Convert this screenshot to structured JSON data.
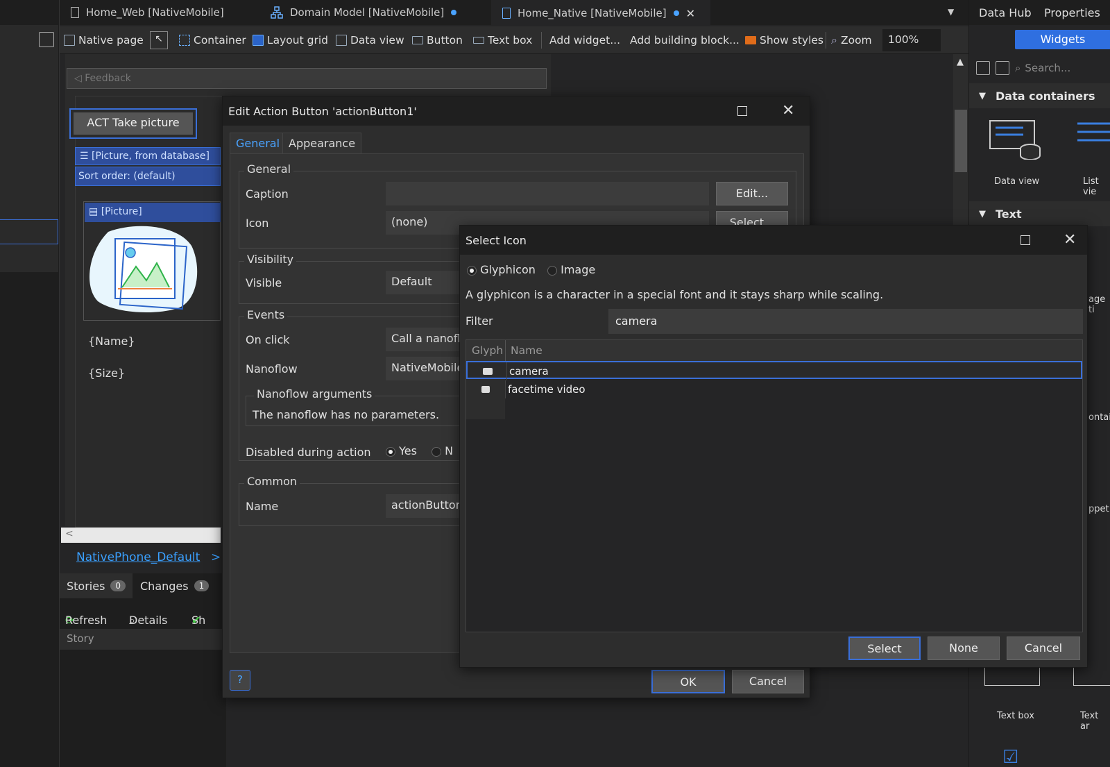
{
  "tabs": [
    {
      "label": "Home_Web [NativeMobile]",
      "dirty": false
    },
    {
      "label": "Domain Model [NativeMobile]",
      "dirty": true
    },
    {
      "label": "Home_Native [NativeMobile]",
      "dirty": true
    }
  ],
  "toolbar": {
    "native_page": "Native page",
    "container": "Container",
    "layout_grid": "Layout grid",
    "data_view": "Data view",
    "button": "Button",
    "text_box": "Text box",
    "add_widget": "Add widget...",
    "add_building_block": "Add building block...",
    "show_styles": "Show styles",
    "zoom_label": "Zoom",
    "zoom_value": "100%"
  },
  "right_panel": {
    "tab_data_hub": "Data Hub",
    "tab_properties": "Properties",
    "widgets_button": "Widgets",
    "search_placeholder": "Search...",
    "section_data_containers": "Data containers",
    "section_text": "Text",
    "items": {
      "data_view": "Data view",
      "list_view": "List vie",
      "image_text": "age ti",
      "container": "ontair",
      "snippet": "ppet",
      "text_box": "Text box",
      "text_area": "Text ar"
    }
  },
  "canvas": {
    "feedback": "Feedback",
    "action_button": "ACT Take picture",
    "list_header": "[Picture, from database]",
    "sort_order": "Sort order: (default)",
    "picture_header": "[Picture]",
    "name_tpl": "{Name}",
    "size_tpl": "{Size}",
    "breadcrumb_link": "NativePhone_Default",
    "breadcrumb_arrow": ">"
  },
  "bottom_pane": {
    "tab_stories": "Stories",
    "stories_count": "0",
    "tab_changes": "Changes",
    "changes_count": "1",
    "refresh": "Refresh",
    "details": "Details",
    "show": "Sh",
    "story_col": "Story"
  },
  "edit_dialog": {
    "title": "Edit Action Button 'actionButton1'",
    "tab_general": "General",
    "tab_appearance": "Appearance",
    "grp_general": "General",
    "caption_label": "Caption",
    "caption_value": "",
    "edit_button": "Edit...",
    "icon_label": "Icon",
    "icon_value": "(none)",
    "select_button": "Select...",
    "grp_visibility": "Visibility",
    "visible_label": "Visible",
    "visible_value": "Default",
    "grp_events": "Events",
    "on_click_label": "On click",
    "on_click_value": "Call a nanoflow",
    "nanoflow_label": "Nanoflow",
    "nanoflow_value": "NativeMobile",
    "grp_nanoflow_args": "Nanoflow arguments",
    "no_params": "The nanoflow has no parameters.",
    "disabled_label": "Disabled during action",
    "yes_label": "Yes",
    "no_label": "N",
    "grp_common": "Common",
    "name_label": "Name",
    "name_value": "actionButton",
    "ok_button": "OK",
    "cancel_button": "Cancel",
    "help": "?"
  },
  "select_dialog": {
    "title": "Select Icon",
    "glyphicon_label": "Glyphicon",
    "image_label": "Image",
    "description": "A glyphicon is a character in a special font and it stays sharp while scaling.",
    "filter_label": "Filter",
    "filter_value": "camera",
    "col_glyph": "Glyph",
    "col_name": "Name",
    "rows": [
      {
        "name": "camera",
        "selected": true
      },
      {
        "name": "facetime video",
        "selected": false
      }
    ],
    "select_button": "Select",
    "none_button": "None",
    "cancel_button": "Cancel"
  }
}
